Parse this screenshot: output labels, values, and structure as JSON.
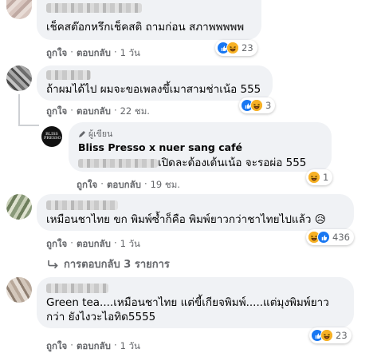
{
  "comments": [
    {
      "text": "เช็คสต๊อกหรึกเช็คสติ ถามก่อน สภาพพพพพ",
      "actions": {
        "like": "ถูกใจ",
        "reply": "ตอบกลับ",
        "time": "1 วัน"
      },
      "reactions": {
        "count": "23",
        "icons": [
          "like-icon",
          "haha-icon"
        ]
      }
    },
    {
      "text": "ถ้าผมได้ไป ผมจะขอเพลงขึ้เมาสามช่าเน้อ 555",
      "actions": {
        "like": "ถูกใจ",
        "reply": "ตอบกลับ",
        "time": "22 ชม."
      },
      "reactions": {
        "count": "3",
        "icons": [
          "like-icon",
          "haha-icon"
        ]
      },
      "reply": {
        "author_badge": "ผู้เขียน",
        "author": "Bliss Presso x nuer sang café",
        "avatar_text": "BLISS PRESSO",
        "text": "เปิดละต้องเต้นเน้อ จะรอผ่อ 555",
        "actions": {
          "like": "ถูกใจ",
          "reply": "ตอบกลับ",
          "time": "19 ชม."
        },
        "reactions": {
          "count": "1",
          "icons": [
            "haha-icon"
          ]
        }
      }
    },
    {
      "text": "เหมือนชาไทย ขก พิมพ์ซ้ำก็คือ พิมพ์ยาวกว่าชาไทยไปแล้ว 😥",
      "actions": {
        "like": "ถูกใจ",
        "reply": "ตอบกลับ",
        "time": "1 วัน"
      },
      "reactions": {
        "count": "436",
        "icons": [
          "haha-icon",
          "like-icon"
        ]
      },
      "replies_link": "การตอบกลับ 3 รายการ"
    },
    {
      "text_line1": "Green tea....เหมือนชาไทย แต่ขี้เกียจพิมพ์.....แต่มุงพิมพ์ยาว",
      "text_line2": "กว่า ยังไงวะไอทิด5555",
      "actions": {
        "like": "ถูกใจ",
        "reply": "ตอบกลับ",
        "time": "1 วัน"
      },
      "reactions": {
        "count": "23",
        "icons": [
          "like-icon",
          "haha-icon"
        ]
      }
    }
  ],
  "dot": "·",
  "colors": {
    "bubble": "#f0f2f5",
    "meta": "#65676b",
    "like": "#1877f2",
    "haha": "#f7b125"
  }
}
